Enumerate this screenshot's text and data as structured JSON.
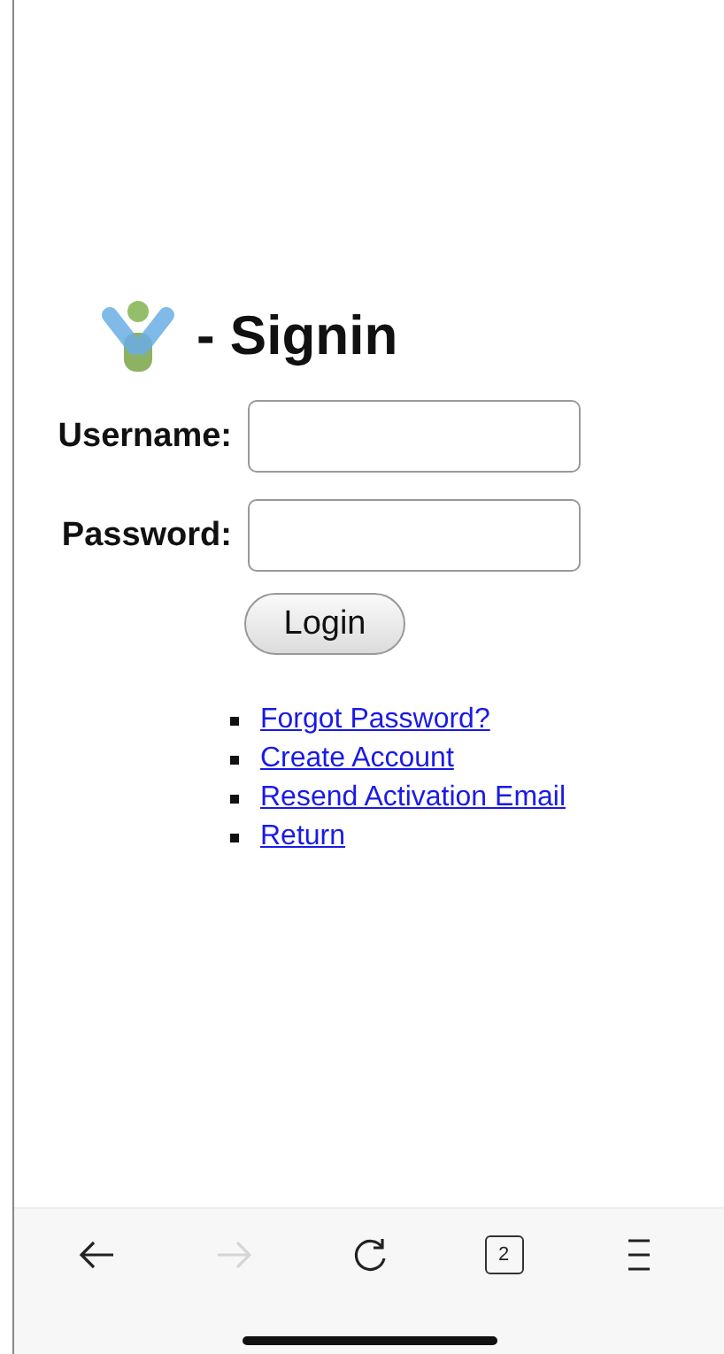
{
  "heading": {
    "title": "- Signin"
  },
  "form": {
    "fields": [
      {
        "label": "Username:"
      },
      {
        "label": "Password:"
      }
    ],
    "submit": "Login"
  },
  "links": [
    "Forgot Password?",
    "Create Account",
    "Resend Activation Email",
    "Return"
  ],
  "toolbar": [
    {
      "kind": "back",
      "disabled": false
    },
    {
      "kind": "forward",
      "disabled": true
    },
    {
      "kind": "reload",
      "disabled": false
    },
    {
      "kind": "tabs",
      "disabled": false,
      "count": "2"
    },
    {
      "kind": "menu",
      "disabled": false
    }
  ]
}
